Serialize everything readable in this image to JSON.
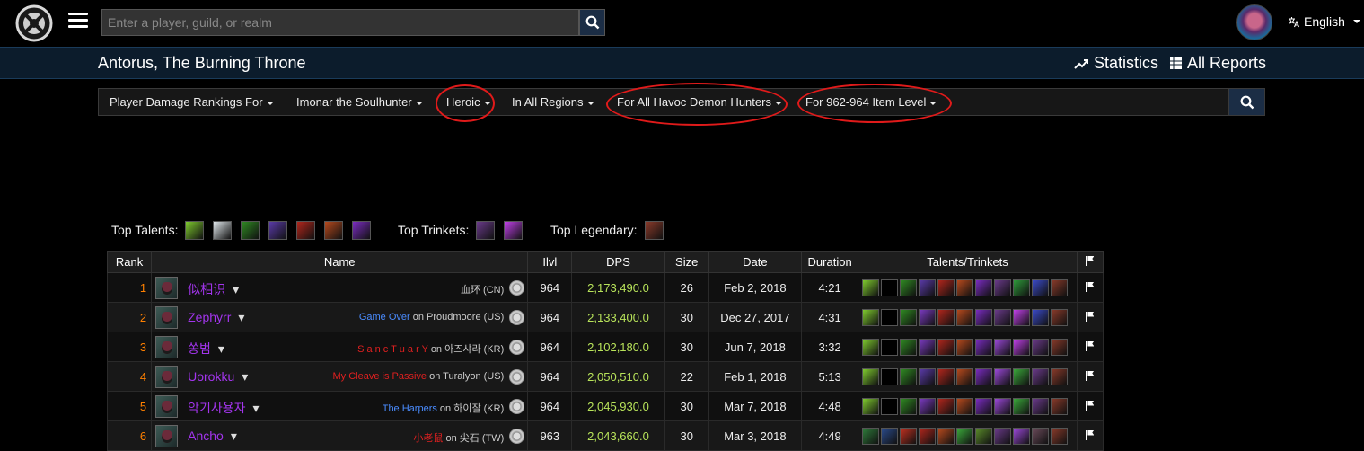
{
  "header": {
    "search_placeholder": "Enter a player, guild, or realm",
    "language": "English"
  },
  "zone": {
    "title": "Antorus, The Burning Throne",
    "statistics": "Statistics",
    "all_reports": "All Reports"
  },
  "filters": [
    {
      "label": "Player Damage Rankings For"
    },
    {
      "label": "Imonar the Soulhunter"
    },
    {
      "label": "Heroic",
      "circled": true
    },
    {
      "label": "In All Regions"
    },
    {
      "label": "For All Havoc Demon Hunters",
      "circled": true
    },
    {
      "label": "For 962-964 Item Level",
      "circled": true
    }
  ],
  "tops": {
    "talents_label": "Top Talents:",
    "trinkets_label": "Top Trinkets:",
    "legendary_label": "Top Legendary:",
    "talent_icons": [
      "#7ec92e",
      "#dfe6ea",
      "#2f8a22",
      "#5a3aa8",
      "#b0261c",
      "#b5491d",
      "#7a2cc0"
    ],
    "trinket_icons": [
      "#6a3a8a",
      "#c040e8"
    ],
    "legendary_icons": [
      "#8a3a2a"
    ]
  },
  "table": {
    "headers": [
      "Rank",
      "Name",
      "Ilvl",
      "DPS",
      "Size",
      "Date",
      "Duration",
      "Talents/Trinkets"
    ],
    "rows": [
      {
        "rank": "1",
        "name": "似相识",
        "guild": "",
        "guild_color": "#ccc",
        "realm": "血环 (CN)",
        "ilvl": "964",
        "dps": "2,173,490.0",
        "size": "26",
        "date": "Feb 2, 2018",
        "duration": "4:21",
        "icons": [
          "#7ec92e",
          "#000000",
          "#2f8a22",
          "#5a3aa8",
          "#b0261c",
          "#b5491d",
          "#7a2cc0",
          "#6a3a8a",
          "#2e9a3a",
          "#3a4ac8",
          "#8a3a2a"
        ]
      },
      {
        "rank": "2",
        "name": "Zephyrr",
        "guild": "Game Over",
        "guild_color": "#4a8cff",
        "realm": "on Proudmoore (US)",
        "ilvl": "964",
        "dps": "2,133,400.0",
        "size": "30",
        "date": "Dec 27, 2017",
        "duration": "4:31",
        "icons": [
          "#7ec92e",
          "#000000",
          "#2f8a22",
          "#7a3ac0",
          "#b0261c",
          "#b5491d",
          "#7a2cc0",
          "#6a3a8a",
          "#c040e8",
          "#3a4ac8",
          "#8a3a2a"
        ]
      },
      {
        "rank": "3",
        "name": "쏭범",
        "guild": "S a n c T u a r Y",
        "guild_color": "#e02020",
        "realm": "on 아즈샤라 (KR)",
        "ilvl": "964",
        "dps": "2,102,180.0",
        "size": "30",
        "date": "Jun 7, 2018",
        "duration": "3:32",
        "icons": [
          "#7ec92e",
          "#000000",
          "#2f8a22",
          "#7a3ac0",
          "#b0261c",
          "#b5491d",
          "#7a2cc0",
          "#9a48d8",
          "#c040e8",
          "#6a3a8a",
          "#8a3a2a"
        ]
      },
      {
        "rank": "4",
        "name": "Uorokku",
        "guild": "My Cleave is Passive",
        "guild_color": "#e02020",
        "realm": "on Turalyon (US)",
        "ilvl": "964",
        "dps": "2,050,510.0",
        "size": "22",
        "date": "Feb 1, 2018",
        "duration": "5:13",
        "icons": [
          "#7ec92e",
          "#000000",
          "#2f8a22",
          "#5a3aa8",
          "#b0261c",
          "#b5491d",
          "#7a2cc0",
          "#9a48d8",
          "#3aa83a",
          "#6a3a8a",
          "#8a3a2a"
        ]
      },
      {
        "rank": "5",
        "name": "악기사용자",
        "guild": "The Harpers",
        "guild_color": "#4a8cff",
        "realm": "on 하이잘 (KR)",
        "ilvl": "964",
        "dps": "2,045,930.0",
        "size": "30",
        "date": "Mar 7, 2018",
        "duration": "4:48",
        "icons": [
          "#7ec92e",
          "#000000",
          "#2f8a22",
          "#7a3ac0",
          "#b0261c",
          "#b5491d",
          "#7a2cc0",
          "#9a48d8",
          "#3aa83a",
          "#6a3a8a",
          "#8a3a2a"
        ]
      },
      {
        "rank": "6",
        "name": "Ancho",
        "guild": "小老鼠",
        "guild_color": "#e02020",
        "realm": "on 尖石 (TW)",
        "ilvl": "963",
        "dps": "2,043,660.0",
        "size": "30",
        "date": "Mar 3, 2018",
        "duration": "4:49",
        "icons": [
          "#2e7a3a",
          "#2a4a8a",
          "#c03020",
          "#b0261c",
          "#b5491d",
          "#3aa83a",
          "#5a8a2a",
          "#6a3a8a",
          "#9a48d8",
          "#6a4a5a",
          "#8a3a2a"
        ]
      }
    ]
  }
}
